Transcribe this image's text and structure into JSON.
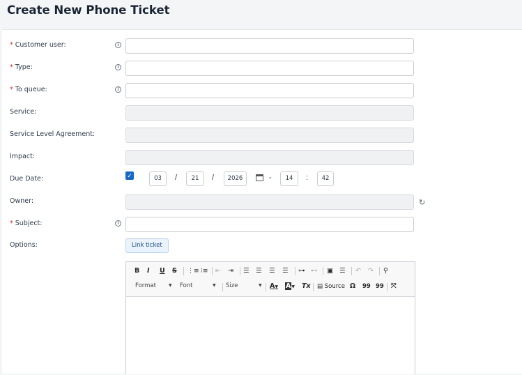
{
  "page": {
    "title": "Create New Phone Ticket"
  },
  "form": {
    "customer_user": {
      "label": "Customer user:",
      "required": "*",
      "value": ""
    },
    "type": {
      "label": "Type:",
      "required": "*",
      "value": ""
    },
    "to_queue": {
      "label": "To queue:",
      "required": "*",
      "value": ""
    },
    "service": {
      "label": "Service:",
      "value": ""
    },
    "sla": {
      "label": "Service Level Agreement:",
      "value": ""
    },
    "impact": {
      "label": "Impact:",
      "value": ""
    },
    "due_date": {
      "label": "Due Date:",
      "month": "03",
      "day": "21",
      "year": "2026",
      "hour": "14",
      "minute": "42",
      "slash": "/",
      "dash": "-",
      "colon": ":"
    },
    "owner": {
      "label": "Owner:",
      "value": ""
    },
    "subject": {
      "label": "Subject:",
      "required": "*",
      "value": ""
    },
    "options": {
      "label": "Options:",
      "link_ticket": "Link ticket"
    }
  },
  "editor": {
    "bold": "B",
    "italic": "I",
    "underline": "U",
    "strike": "S",
    "format": "Format",
    "font": "Font",
    "size": "Size",
    "source": "Source",
    "clear_format": "Tx",
    "special_char": "Ω",
    "quote": "99",
    "quote2": "99"
  },
  "icons": {
    "info": "i",
    "check": "✓",
    "refresh": "↻"
  }
}
